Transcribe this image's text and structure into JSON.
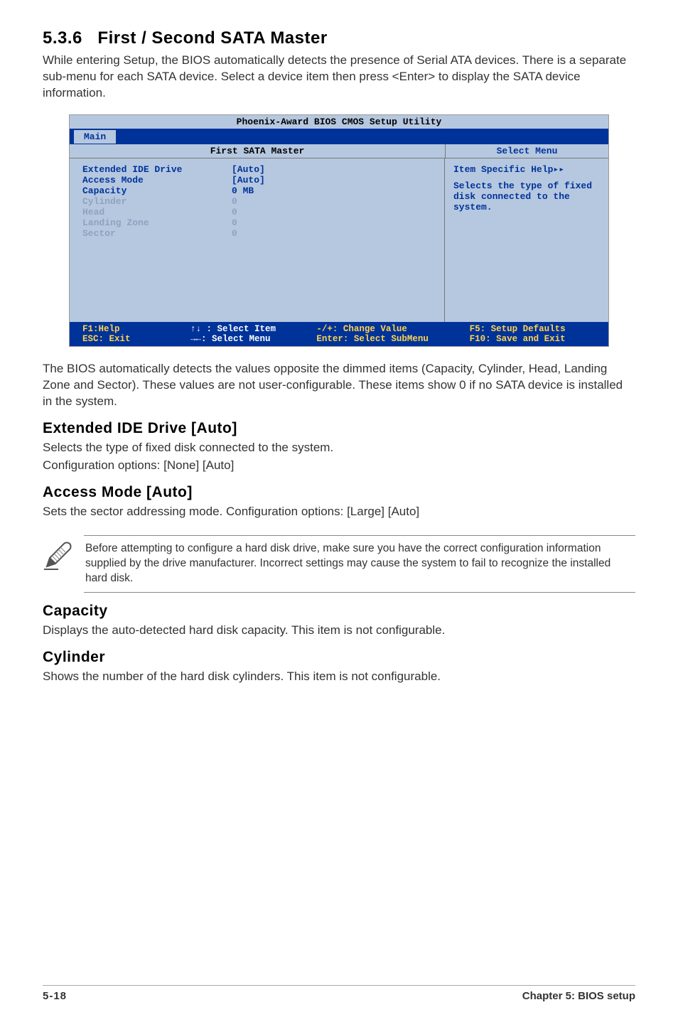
{
  "section": {
    "number": "5.3.6",
    "title": "First / Second SATA Master",
    "intro": "While entering Setup, the BIOS automatically detects the presence of Serial ATA devices. There is a separate sub-menu for each SATA device. Select a device item then press <Enter> to display the SATA device information."
  },
  "bios": {
    "utility_title": "Phoenix-Award BIOS CMOS Setup Utility",
    "tab": "Main",
    "panel_title": "First SATA Master",
    "help_header": "Select Menu",
    "items": [
      {
        "label": "Extended IDE Drive",
        "value": "[Auto]",
        "dim": false
      },
      {
        "label": "Access Mode",
        "value": "[Auto]",
        "dim": false
      },
      {
        "label": "",
        "value": "",
        "dim": false
      },
      {
        "label": "Capacity",
        "value": "0 MB",
        "dim": false
      },
      {
        "label": "",
        "value": "",
        "dim": false
      },
      {
        "label": "Cylinder",
        "value": "0",
        "dim": true
      },
      {
        "label": "Head",
        "value": "0",
        "dim": true
      },
      {
        "label": "Landing Zone",
        "value": "0",
        "dim": true
      },
      {
        "label": "Sector",
        "value": "0",
        "dim": true
      }
    ],
    "help_title": "Item Specific Help▸▸",
    "help_body": "Selects the type of fixed disk connected to the system.",
    "footer": {
      "f1": "F1:Help",
      "esc": "ESC: Exit",
      "select_item": "↑↓ : Select Item",
      "select_menu": "→←: Select Menu",
      "change_value": "-/+: Change Value",
      "enter_submenu": "Enter: Select SubMenu",
      "f5": "F5: Setup Defaults",
      "f10": "F10: Save and Exit"
    }
  },
  "post_bios_text": "The BIOS automatically detects the values opposite the dimmed items (Capacity, Cylinder,  Head, Landing Zone and Sector). These values are not user-configurable. These items show 0 if no SATA device is installed in the system.",
  "sub1": {
    "heading": "Extended IDE Drive [Auto]",
    "line1": "Selects the type of fixed disk connected to the system.",
    "line2": "Configuration options: [None] [Auto]"
  },
  "sub2": {
    "heading": "Access Mode [Auto]",
    "line1": "Sets the sector addressing mode. Configuration options: [Large] [Auto]"
  },
  "note": "Before attempting to configure a hard disk drive, make sure you have the correct configuration information supplied by the drive manufacturer. Incorrect settings may cause the system to fail to recognize the installed hard disk.",
  "sub3": {
    "heading": "Capacity",
    "line1": "Displays the auto-detected hard disk capacity. This item is not configurable."
  },
  "sub4": {
    "heading": "Cylinder",
    "line1": "Shows the number of the hard disk cylinders. This item is not configurable."
  },
  "footer": {
    "page": "5-18",
    "chapter": "Chapter 5: BIOS setup"
  }
}
